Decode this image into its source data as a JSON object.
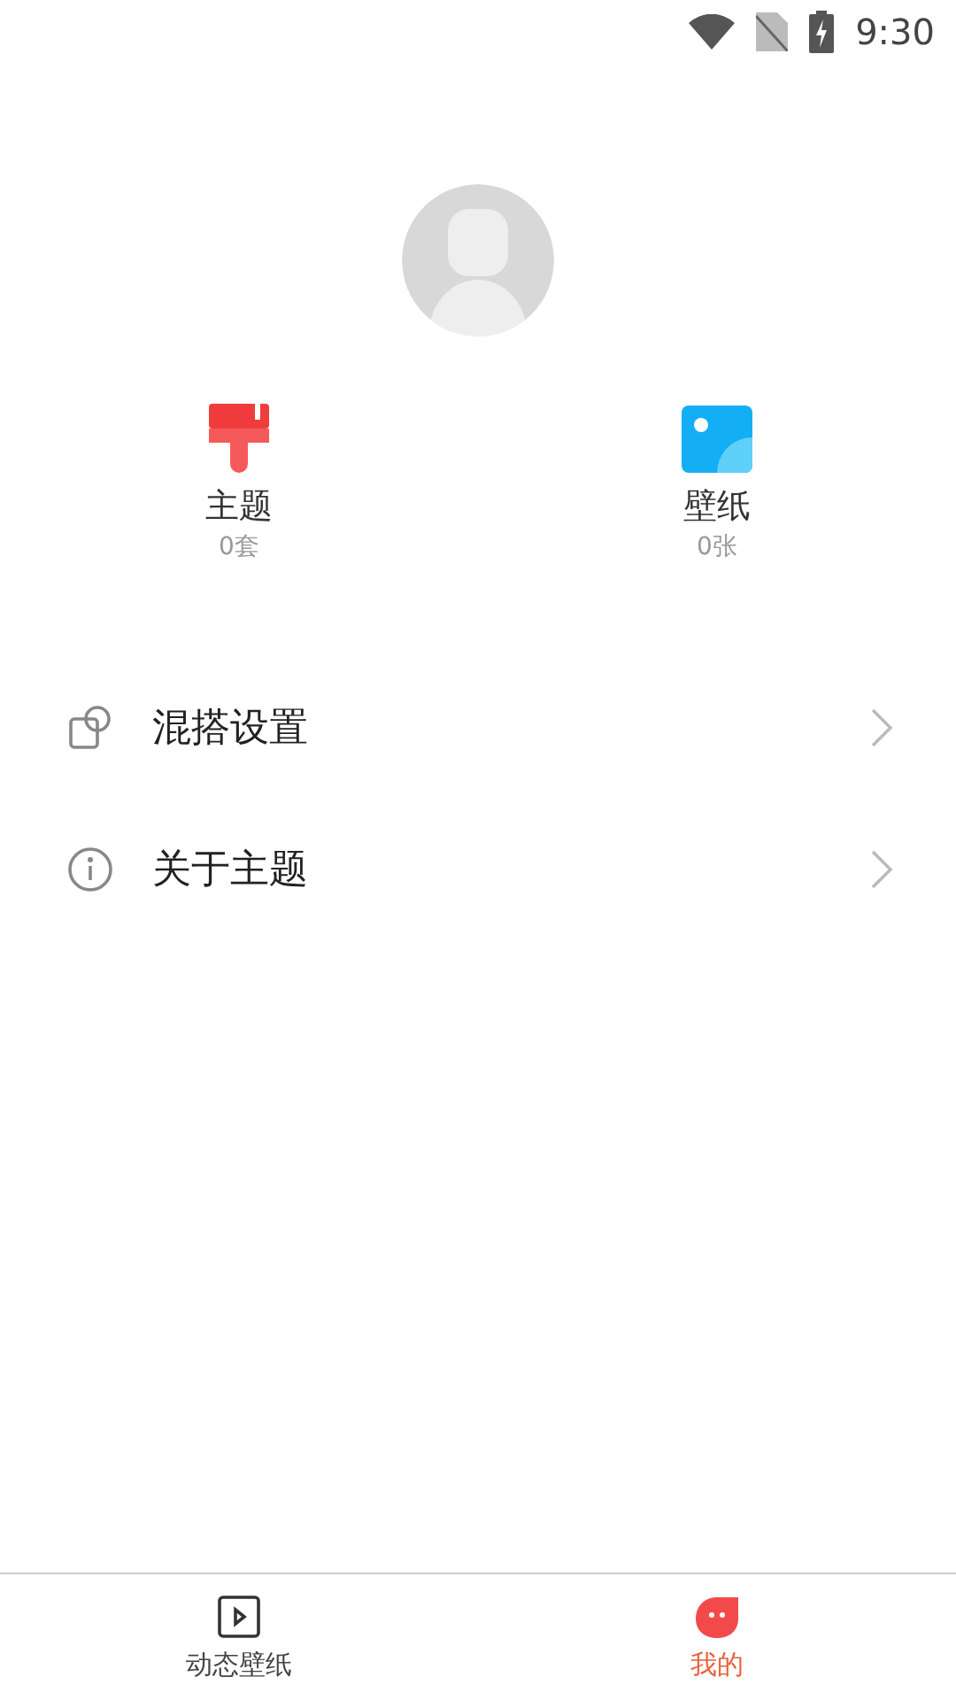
{
  "status_bar": {
    "time": "9:30"
  },
  "stats": [
    {
      "kind": "brush",
      "label": "主题",
      "count": "0套"
    },
    {
      "kind": "image",
      "label": "壁纸",
      "count": "0张"
    }
  ],
  "menu": [
    {
      "kind": "mix",
      "label": "混搭设置"
    },
    {
      "kind": "info",
      "label": "关于主题"
    }
  ],
  "tabs": [
    {
      "kind": "play",
      "label": "动态壁纸",
      "selected": false
    },
    {
      "kind": "mascot",
      "label": "我的",
      "selected": true
    }
  ]
}
